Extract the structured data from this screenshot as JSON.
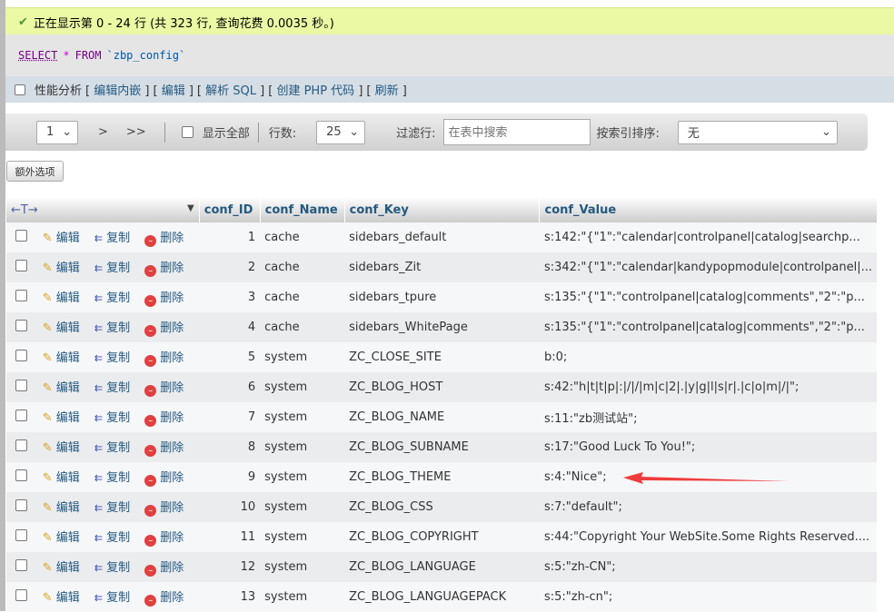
{
  "success_message": "正在显示第 0 - 24 行 (共 323 行, 查询花费 0.0035 秒。)",
  "sql": {
    "select": "SELECT",
    "star": "*",
    "from": "FROM",
    "table": "`zbp_config`"
  },
  "options": {
    "profiling": "性能分析",
    "links": [
      "编辑内嵌",
      "编辑",
      "解析 SQL",
      "创建 PHP 代码",
      "刷新"
    ]
  },
  "nav": {
    "page": "1",
    "next": ">",
    "last": ">>",
    "show_all": "显示全部",
    "rows_label": "行数:",
    "rows_value": "25",
    "filter_label": "过滤行:",
    "filter_placeholder": "在表中搜索",
    "sort_label": "按索引排序:",
    "sort_value": "无"
  },
  "extra_options": "额外选项",
  "table": {
    "columns": [
      "conf_ID",
      "conf_Name",
      "conf_Key",
      "conf_Value"
    ],
    "actions": {
      "edit": "编辑",
      "copy": "复制",
      "delete": "删除"
    },
    "rows": [
      [
        "1",
        "cache",
        "sidebars_default",
        "s:142:\"{\"1\":\"calendar|controlpanel|catalog|searchp..."
      ],
      [
        "2",
        "cache",
        "sidebars_Zit",
        "s:342:\"{\"1\":\"calendar|kandypopmodule|controlpanel|..."
      ],
      [
        "3",
        "cache",
        "sidebars_tpure",
        "s:135:\"{\"1\":\"controlpanel|catalog|comments\",\"2\":\"p..."
      ],
      [
        "4",
        "cache",
        "sidebars_WhitePage",
        "s:135:\"{\"1\":\"controlpanel|catalog|comments\",\"2\":\"p..."
      ],
      [
        "5",
        "system",
        "ZC_CLOSE_SITE",
        "b:0;"
      ],
      [
        "6",
        "system",
        "ZC_BLOG_HOST",
        "s:42:\"h|t|t|p|:|/|/|m|c|2|.|y|g|l|s|r|.|c|o|m|/|\";"
      ],
      [
        "7",
        "system",
        "ZC_BLOG_NAME",
        "s:11:\"zb测试站\";"
      ],
      [
        "8",
        "system",
        "ZC_BLOG_SUBNAME",
        "s:17:\"Good Luck To You!\";"
      ],
      [
        "9",
        "system",
        "ZC_BLOG_THEME",
        "s:4:\"Nice\";"
      ],
      [
        "10",
        "system",
        "ZC_BLOG_CSS",
        "s:7:\"default\";"
      ],
      [
        "11",
        "system",
        "ZC_BLOG_COPYRIGHT",
        "s:44:\"Copyright Your WebSite.Some Rights Reserved...."
      ],
      [
        "12",
        "system",
        "ZC_BLOG_LANGUAGE",
        "s:5:\"zh-CN\";"
      ],
      [
        "13",
        "system",
        "ZC_BLOG_LANGUAGEPACK",
        "s:5:\"zh-cn\";"
      ]
    ]
  },
  "colors": {
    "accent": "#235a81",
    "success_bg": "#ebf8a4",
    "arrow": "#f03c3c"
  }
}
